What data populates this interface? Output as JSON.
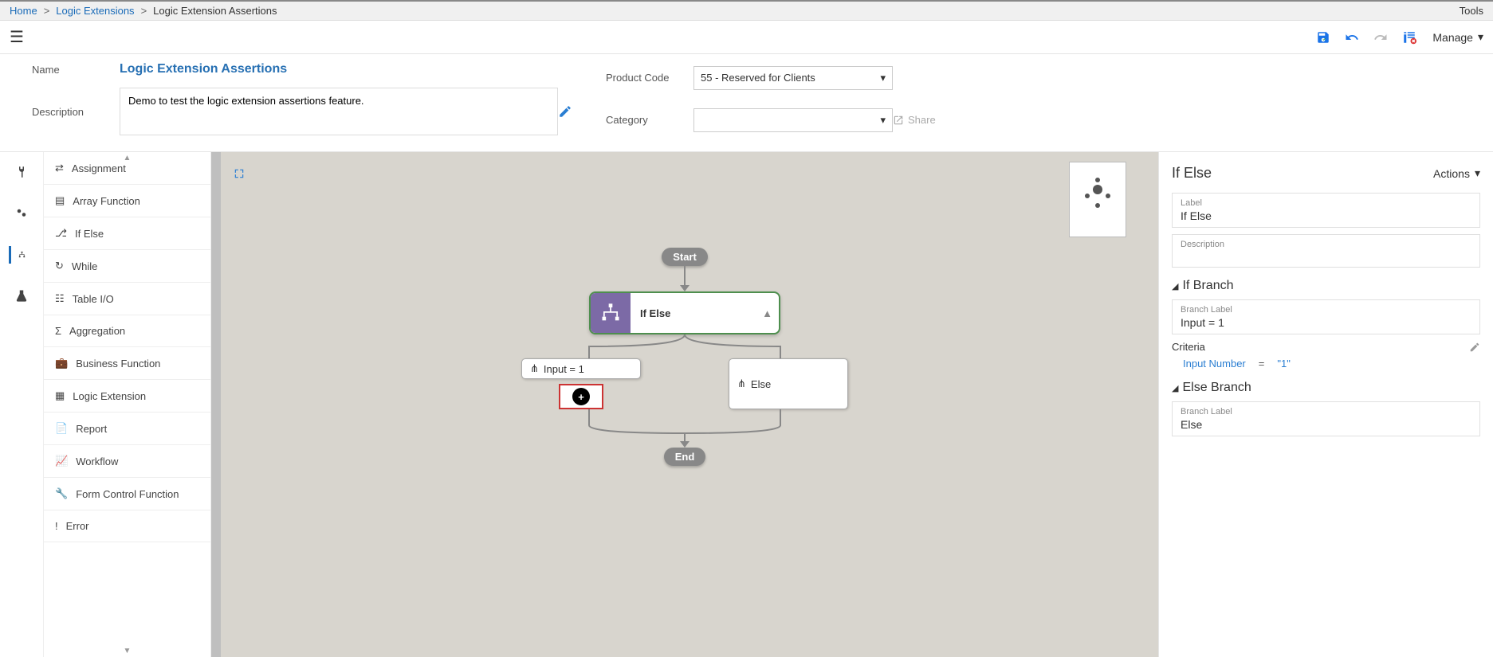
{
  "breadcrumb": {
    "home": "Home",
    "logic_extensions": "Logic Extensions",
    "current": "Logic Extension Assertions"
  },
  "tools": "Tools",
  "header": {
    "manage": "Manage"
  },
  "form": {
    "name_label": "Name",
    "name_value": "Logic Extension Assertions",
    "description_label": "Description",
    "description_value": "Demo to test the logic extension assertions feature.",
    "product_code_label": "Product Code",
    "product_code_value": "55 - Reserved for Clients",
    "category_label": "Category",
    "category_value": "",
    "share": "Share"
  },
  "palette": [
    "Assignment",
    "Array Function",
    "If Else",
    "While",
    "Table I/O",
    "Aggregation",
    "Business Function",
    "Logic Extension",
    "Report",
    "Workflow",
    "Form Control Function",
    "Error"
  ],
  "flow": {
    "start": "Start",
    "ifelse": "If Else",
    "branch1": "Input = 1",
    "branch2": "Else",
    "end": "End"
  },
  "right_panel": {
    "title": "If Else",
    "actions": "Actions",
    "label_field": "Label",
    "label_value": "If Else",
    "description_field": "Description",
    "if_branch": "If Branch",
    "branch_label_field": "Branch Label",
    "branch_label_value": "Input = 1",
    "criteria_label": "Criteria",
    "criteria_lhs": "Input Number",
    "criteria_op": "=",
    "criteria_rhs": "\"1\"",
    "else_branch": "Else Branch",
    "else_label_value": "Else"
  }
}
